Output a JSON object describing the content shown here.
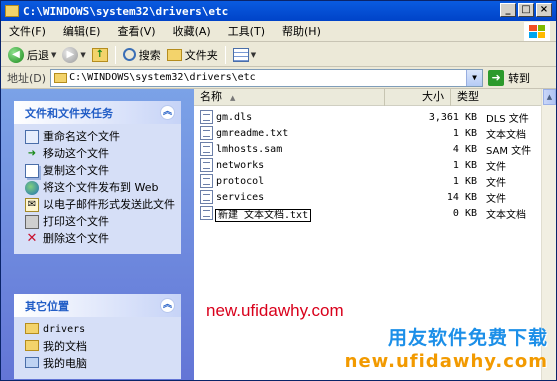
{
  "window": {
    "title": "C:\\WINDOWS\\system32\\drivers\\etc",
    "controls": [
      "_",
      "□",
      "×"
    ]
  },
  "menu": [
    "文件(F)",
    "编辑(E)",
    "查看(V)",
    "收藏(A)",
    "工具(T)",
    "帮助(H)"
  ],
  "toolbar": {
    "back_label": "后退",
    "search_label": "搜索",
    "folders_label": "文件夹"
  },
  "address": {
    "label": "地址(D)",
    "value": "C:\\WINDOWS\\system32\\drivers\\etc",
    "go_label": "转到"
  },
  "tasks_panel": {
    "title": "文件和文件夹任务",
    "items": [
      {
        "label": "重命名这个文件",
        "icon": "rename-icon"
      },
      {
        "label": "移动这个文件",
        "icon": "move-icon"
      },
      {
        "label": "复制这个文件",
        "icon": "copy-icon"
      },
      {
        "label": "将这个文件发布到 Web",
        "icon": "globe-icon"
      },
      {
        "label": "以电子邮件形式发送此文件",
        "icon": "email-icon"
      },
      {
        "label": "打印这个文件",
        "icon": "printer-icon"
      },
      {
        "label": "删除这个文件",
        "icon": "delete-icon"
      }
    ]
  },
  "places_panel": {
    "title": "其它位置",
    "items": [
      {
        "label": "drivers",
        "icon": "folder-icon"
      },
      {
        "label": "我的文档",
        "icon": "folder-icon"
      },
      {
        "label": "我的电脑",
        "icon": "computer-icon"
      }
    ]
  },
  "columns": {
    "name": "名称",
    "size": "大小",
    "type": "类型"
  },
  "files": [
    {
      "name": "gm.dls",
      "size": "3,361 KB",
      "type": "DLS 文件"
    },
    {
      "name": "gmreadme.txt",
      "size": "1 KB",
      "type": "文本文档"
    },
    {
      "name": "lmhosts.sam",
      "size": "4 KB",
      "type": "SAM 文件"
    },
    {
      "name": "networks",
      "size": "1 KB",
      "type": "文件"
    },
    {
      "name": "protocol",
      "size": "1 KB",
      "type": "文件"
    },
    {
      "name": "services",
      "size": "14 KB",
      "type": "文件"
    },
    {
      "name": "新建 文本文档.txt",
      "size": "0 KB",
      "type": "文本文档",
      "selected": true
    }
  ],
  "watermarks": {
    "site": "new.ufidawhy.com",
    "brand": "用友软件免费下载",
    "site2": "new.ufidawhy.com"
  },
  "colors": {
    "title_bar": "#0a5be0",
    "task_pane": "#6375d6",
    "watermark_red": "#d9001b",
    "watermark_blue": "#1c8fe8",
    "watermark_orange": "#f29a00"
  }
}
